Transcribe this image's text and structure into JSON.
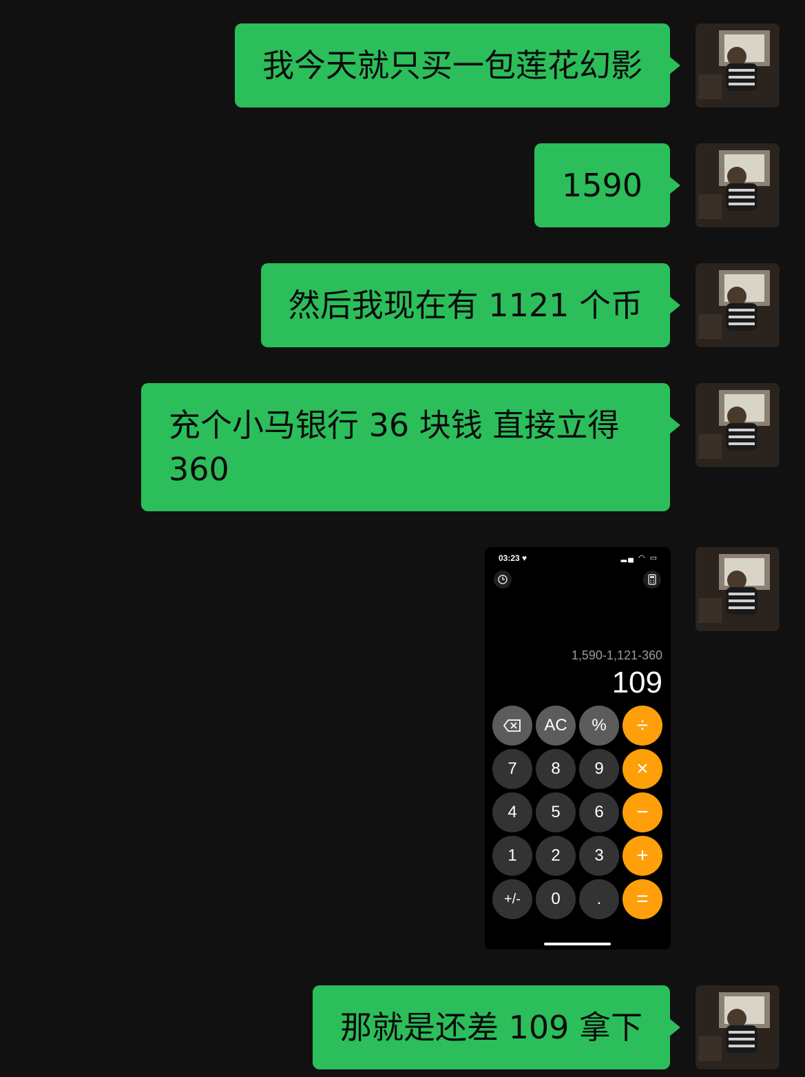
{
  "messages": [
    {
      "text": "我今天就只买一包莲花幻影"
    },
    {
      "text": "1590"
    },
    {
      "text": "然后我现在有 1121 个币"
    },
    {
      "text": "充个小马银行 36 块钱 直接立得 360"
    },
    {
      "text": "那就是还差 109 拿下"
    }
  ],
  "calculator": {
    "status_time": "03:23 ♥",
    "status_icons": "▂▄ ◠ ▭",
    "history_icon": "history-icon",
    "calc_icon": "calculator-icon",
    "expression": "1,590-1,121-360",
    "result": "109",
    "keys": [
      [
        "⌫",
        "AC",
        "%",
        "÷"
      ],
      [
        "7",
        "8",
        "9",
        "×"
      ],
      [
        "4",
        "5",
        "6",
        "−"
      ],
      [
        "1",
        "2",
        "3",
        "+"
      ],
      [
        "+/-",
        "0",
        ".",
        "="
      ]
    ]
  },
  "colors": {
    "background": "#111111",
    "bubble": "#2bbe5a",
    "operator": "#ff9f0a"
  }
}
